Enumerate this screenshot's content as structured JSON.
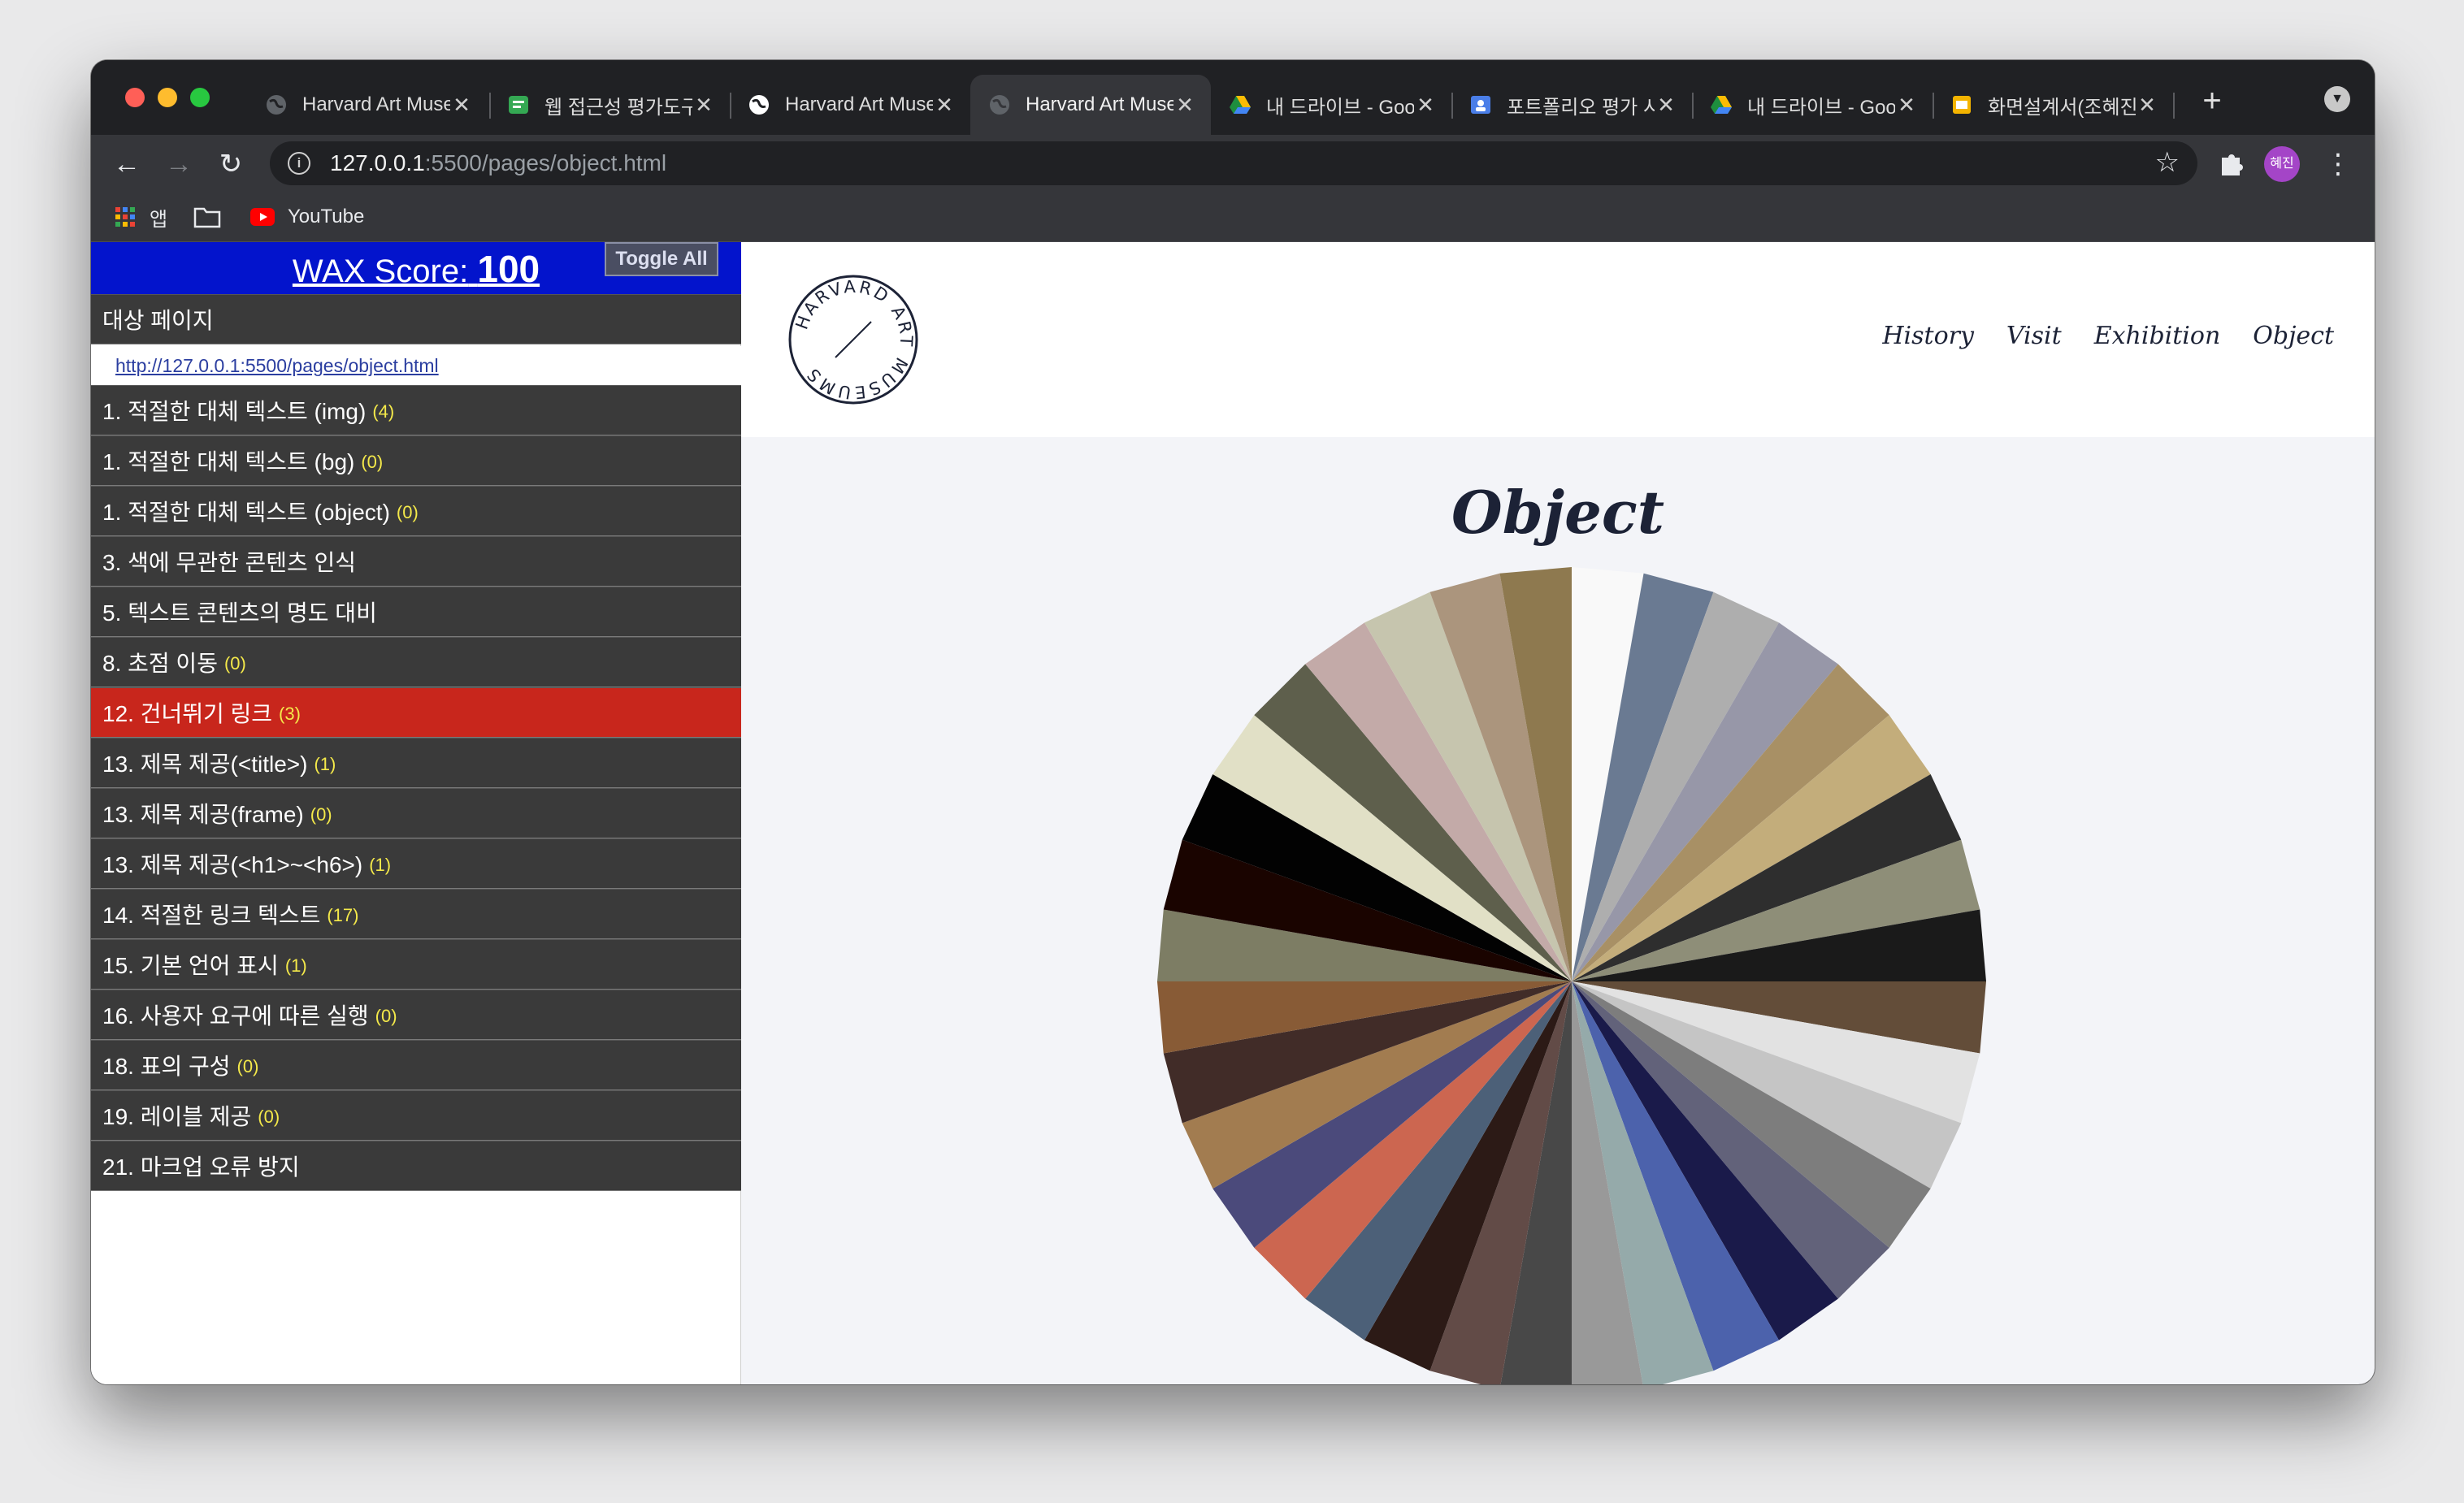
{
  "browser": {
    "tabs": [
      {
        "title": "Harvard Art Museums",
        "icon": "globe-gray",
        "active": false
      },
      {
        "title": "웹 접근성 평가도구",
        "icon": "chat-green",
        "active": false
      },
      {
        "title": "Harvard Art Museums",
        "icon": "globe-white",
        "active": false
      },
      {
        "title": "Harvard Art Museums",
        "icon": "globe-gray",
        "active": true
      },
      {
        "title": "내 드라이브 - Google Drive",
        "icon": "drive",
        "active": false
      },
      {
        "title": "포트폴리오 평가 시트",
        "icon": "classroom-blue",
        "active": false
      },
      {
        "title": "내 드라이브 - Google Drive",
        "icon": "drive",
        "active": false
      },
      {
        "title": "화면설계서(조혜진)",
        "icon": "slides-yellow",
        "active": false
      }
    ],
    "url_host": "127.0.0.1",
    "url_path": ":5500/pages/object.html",
    "profile_initials": "혜진",
    "bookmarks": [
      {
        "label": "앱",
        "icon": "apps-grid-icon"
      },
      {
        "label": "",
        "icon": "folder-icon"
      },
      {
        "label": "YouTube",
        "icon": "youtube-icon"
      }
    ]
  },
  "wax": {
    "score_label": "WAX Score:",
    "score_value": "100",
    "toggle_label": "Toggle All",
    "target_label": "대상 페이지",
    "target_url": "http://127.0.0.1:5500/pages/object.html",
    "items": [
      {
        "label": "1. 적절한 대체 텍스트 (img)",
        "count": "(4)"
      },
      {
        "label": "1. 적절한 대체 텍스트 (bg)",
        "count": "(0)"
      },
      {
        "label": "1. 적절한 대체 텍스트 (object)",
        "count": "(0)"
      },
      {
        "label": "3. 색에 무관한 콘텐츠 인식",
        "count": ""
      },
      {
        "label": "5. 텍스트 콘텐츠의 명도 대비",
        "count": ""
      },
      {
        "label": "8. 초점 이동",
        "count": "(0)"
      },
      {
        "label": "12. 건너뛰기 링크",
        "count": "(3)",
        "active": true
      },
      {
        "label": "13. 제목 제공(<title>)",
        "count": "(1)"
      },
      {
        "label": "13. 제목 제공(frame)",
        "count": "(0)"
      },
      {
        "label": "13. 제목 제공(<h1>~<h6>)",
        "count": "(1)"
      },
      {
        "label": "14. 적절한 링크 텍스트",
        "count": "(17)"
      },
      {
        "label": "15. 기본 언어 표시",
        "count": "(1)"
      },
      {
        "label": "16. 사용자 요구에 따른 실행",
        "count": "(0)"
      },
      {
        "label": "18. 표의 구성",
        "count": "(0)"
      },
      {
        "label": "19. 레이블 제공",
        "count": "(0)"
      },
      {
        "label": "21. 마크업 오류 방지",
        "count": ""
      }
    ]
  },
  "site": {
    "logo_text": "HARVARD ART MUSEUMS",
    "nav": [
      "History",
      "Visit",
      "Exhibition",
      "Object"
    ],
    "page_title": "Object",
    "wheel_colors": [
      "#f9f9f9",
      "#6a7a92",
      "#aeaeae",
      "#9797a8",
      "#a89065",
      "#c3ad7b",
      "#2e2e2e",
      "#8e8e78",
      "#1a1a1a",
      "#634d39",
      "#e2e2e2",
      "#c5c5c5",
      "#7d7d7d",
      "#62627a",
      "#1a1a4a",
      "#4c62ac",
      "#95aaaa",
      "#999999",
      "#484848",
      "#624b47",
      "#2c1a16",
      "#4c6078",
      "#cc6650",
      "#4b4a7b",
      "#a27c50",
      "#412c28",
      "#885b36",
      "#7d7d64",
      "#1a0400",
      "#020202",
      "#e1e0c6",
      "#5e5f4c",
      "#c3aaa8",
      "#c6c5ae",
      "#ab957d",
      "#8e794f"
    ]
  }
}
